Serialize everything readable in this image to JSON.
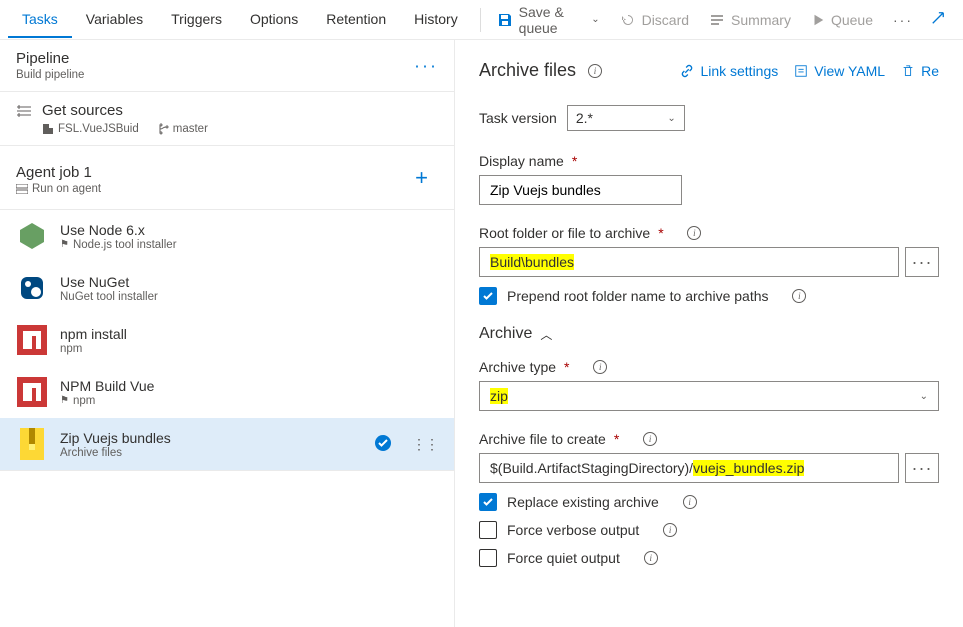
{
  "tabs": [
    "Tasks",
    "Variables",
    "Triggers",
    "Options",
    "Retention",
    "History"
  ],
  "activeTab": 0,
  "topActions": {
    "save": "Save & queue",
    "discard": "Discard",
    "summary": "Summary",
    "queue": "Queue"
  },
  "pipeline": {
    "title": "Pipeline",
    "subtitle": "Build pipeline"
  },
  "sources": {
    "title": "Get sources",
    "repo": "FSL.VueJSBuid",
    "branch": "master"
  },
  "agent": {
    "title": "Agent job 1",
    "subtitle": "Run on agent"
  },
  "tasks": [
    {
      "name": "Use Node 6.x",
      "type": "Node.js tool installer"
    },
    {
      "name": "Use NuGet",
      "type": "NuGet tool installer"
    },
    {
      "name": "npm install",
      "type": "npm"
    },
    {
      "name": "NPM Build Vue",
      "type": "npm"
    },
    {
      "name": "Zip Vuejs bundles",
      "type": "Archive files"
    }
  ],
  "right": {
    "title": "Archive files",
    "links": {
      "link": "Link settings",
      "yaml": "View YAML",
      "remove": "Re"
    },
    "taskVersion": {
      "label": "Task version",
      "value": "2.*"
    },
    "displayName": {
      "label": "Display name",
      "value": "Zip Vuejs bundles"
    },
    "rootFolder": {
      "label": "Root folder or file to archive",
      "highlight": "Build\\bundles"
    },
    "prepend": {
      "label": "Prepend root folder name to archive paths",
      "checked": true
    },
    "archiveSection": "Archive",
    "archiveType": {
      "label": "Archive type",
      "value": "zip"
    },
    "archiveFile": {
      "label": "Archive file to create",
      "prefix": "$(Build.ArtifactStagingDirectory)/",
      "highlight": "vuejs_bundles.zip"
    },
    "replace": {
      "label": "Replace existing archive",
      "checked": true
    },
    "verbose": {
      "label": "Force verbose output",
      "checked": false
    },
    "quiet": {
      "label": "Force quiet output",
      "checked": false
    }
  }
}
